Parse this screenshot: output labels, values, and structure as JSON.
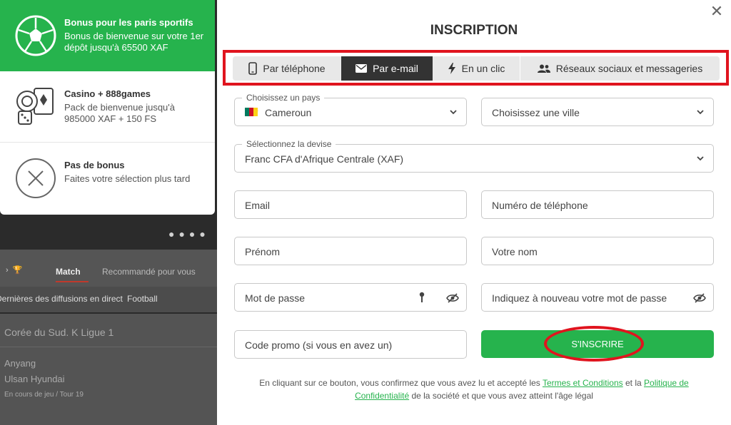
{
  "background": {
    "tabs": [
      "Match",
      "Recommandé pour vous"
    ],
    "filters": [
      "Dernières des diffusions en direct",
      "Football"
    ],
    "league": "Corée du Sud. K Ligue 1",
    "teams": [
      "Anyang",
      "Ulsan Hyundai"
    ],
    "round": "En cours de jeu / Tour 19"
  },
  "bonus": {
    "items": [
      {
        "icon": "soccer-ball-icon",
        "title": "Bonus pour les paris sportifs",
        "desc": "Bonus de bienvenue sur votre 1er dépôt jusqu'à 65500 XAF",
        "active": true
      },
      {
        "icon": "casino-chips-cards-icon",
        "title": "Casino + 888games",
        "desc": "Pack de bienvenue jusqu'à 985000 XAF + 150 FS",
        "active": false
      },
      {
        "icon": "no-bonus-x-icon",
        "title": "Pas de bonus",
        "desc": "Faites votre sélection plus tard",
        "active": false
      }
    ]
  },
  "modal": {
    "title": "INSCRIPTION",
    "close_icon": "close-icon",
    "tabs": [
      {
        "label": "Par téléphone",
        "icon": "phone-icon"
      },
      {
        "label": "Par e-mail",
        "icon": "envelope-icon",
        "active": true
      },
      {
        "label": "En un clic",
        "icon": "lightning-icon"
      },
      {
        "label": "Réseaux sociaux et messageries",
        "icon": "users-icon"
      }
    ],
    "form": {
      "country_label": "Choisissez un pays",
      "country_value": "Cameroun",
      "city_placeholder": "Choisissez une ville",
      "currency_label": "Sélectionnez la devise",
      "currency_value": "Franc CFA d'Afrique Centrale (XAF)",
      "email_placeholder": "Email",
      "phone_placeholder": "Numéro de téléphone",
      "firstname_placeholder": "Prénom",
      "lastname_placeholder": "Votre nom",
      "password_placeholder": "Mot de passe",
      "password_confirm_placeholder": "Indiquez à nouveau votre mot de passe",
      "promo_placeholder": "Code promo (si vous en avez un)",
      "submit_label": "S'INSCRIRE"
    },
    "legal": {
      "before": "En cliquant sur ce bouton, vous confirmez que vous avez lu et accepté les ",
      "terms_link": "Termes et Conditions",
      "middle": " et la ",
      "privacy_link": "Politique de Confidentialité",
      "after": " de la société et que vous avez atteint l'âge légal"
    }
  },
  "colors": {
    "accent_green": "#26b34d",
    "highlight_red": "#e0141e",
    "active_tab": "#333333"
  }
}
